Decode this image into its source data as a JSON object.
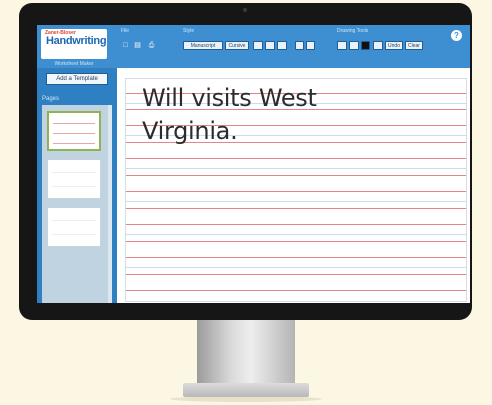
{
  "app": {
    "logo_small": "Zaner-Bloser",
    "logo_main": "Handwriting",
    "logo_sub": "Worksheet Maker"
  },
  "toolbar": {
    "group_file": "File",
    "group_style": "Style",
    "group_drawing": "Drawing Tools",
    "manuscript_label": "Manuscript",
    "cursive_label": "Cursive",
    "undo_label": "Undo",
    "clear_label": "Clear",
    "help_label": "?"
  },
  "sidebar": {
    "add_template_label": "Add a Template",
    "pages_label": "Pages"
  },
  "document": {
    "line1": "Will visits West",
    "line2": "Virginia."
  },
  "colors": {
    "toolbar": "#3d8fd1",
    "sidebar": "#2f7fc3",
    "rule_red": "#e3868c",
    "rule_blue": "#c9ddf0"
  }
}
